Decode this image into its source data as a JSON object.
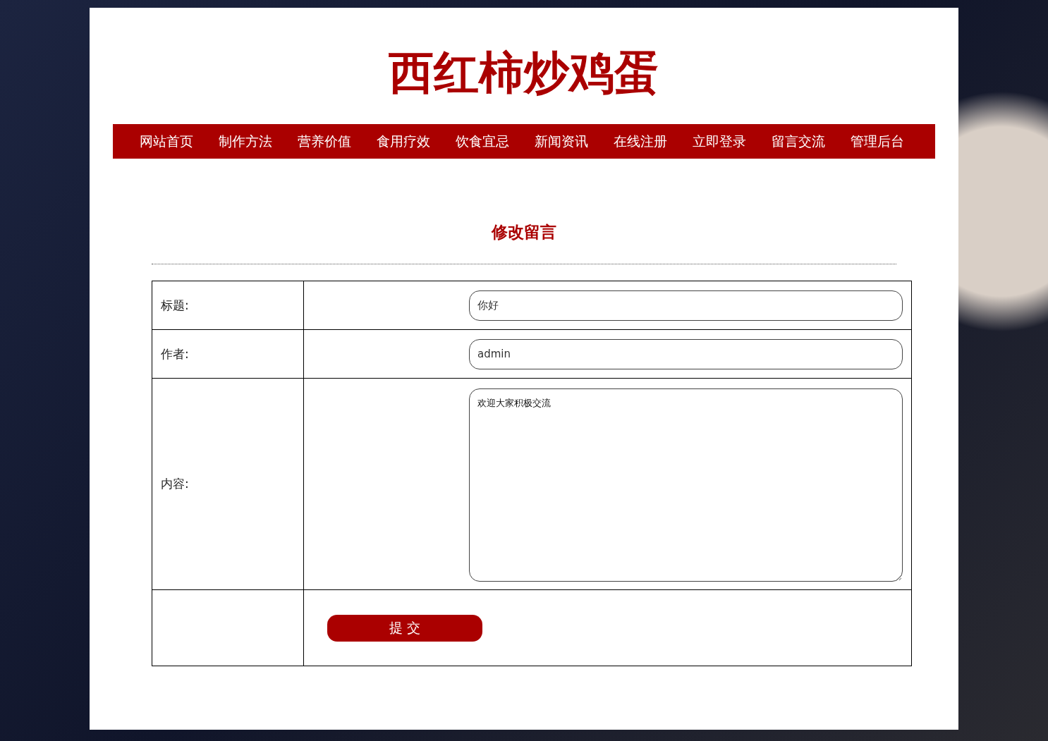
{
  "site_title": "西红柿炒鸡蛋",
  "nav": [
    {
      "label": "网站首页"
    },
    {
      "label": "制作方法"
    },
    {
      "label": "营养价值"
    },
    {
      "label": "食用疗效"
    },
    {
      "label": "饮食宜忌"
    },
    {
      "label": "新闻资讯"
    },
    {
      "label": "在线注册"
    },
    {
      "label": "立即登录"
    },
    {
      "label": "留言交流"
    },
    {
      "label": "管理后台"
    }
  ],
  "form": {
    "heading": "修改留言",
    "fields": [
      {
        "kind": "input",
        "label": "标题:",
        "value": "你好"
      },
      {
        "kind": "input",
        "label": "作者:",
        "value": "admin"
      },
      {
        "kind": "textarea",
        "label": "内容:",
        "value": "欢迎大家积极交流"
      }
    ],
    "submit": "提 交"
  }
}
